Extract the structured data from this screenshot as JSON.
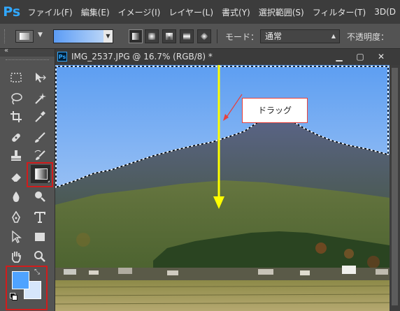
{
  "app": {
    "logo": "Ps"
  },
  "menu": {
    "items": [
      "ファイル(F)",
      "編集(E)",
      "イメージ(I)",
      "レイヤー(L)",
      "書式(Y)",
      "選択範囲(S)",
      "フィルター(T)",
      "3D(D"
    ]
  },
  "options": {
    "mode_label": "モード：",
    "mode_value": "通常",
    "opacity_label": "不透明度：",
    "gradient_colors": [
      "#5b9cf5",
      "#c9def8"
    ]
  },
  "document": {
    "ps_icon": "Ps",
    "title": "IMG_2537.JPG @ 16.7% (RGB/8) *",
    "minimize": "▁",
    "maximize": "▢",
    "close": "✕"
  },
  "annotation": {
    "drag_label": "ドラッグ"
  },
  "colors": {
    "foreground": "#4fa3ff",
    "background": "#d6e6fb",
    "highlight_frame": "#d11c1c",
    "drag_arrow": "#ffff00"
  },
  "tools": [
    "rectangular-marquee-icon",
    "move-icon",
    "lasso-icon",
    "magic-wand-icon",
    "crop-icon",
    "eyedropper-icon",
    "spot-healing-icon",
    "brush-icon",
    "clone-stamp-icon",
    "history-brush-icon",
    "eraser-icon",
    "gradient-icon",
    "blur-icon",
    "dodge-icon",
    "pen-icon",
    "type-icon",
    "path-selection-icon",
    "rectangle-icon",
    "hand-icon",
    "zoom-icon"
  ]
}
